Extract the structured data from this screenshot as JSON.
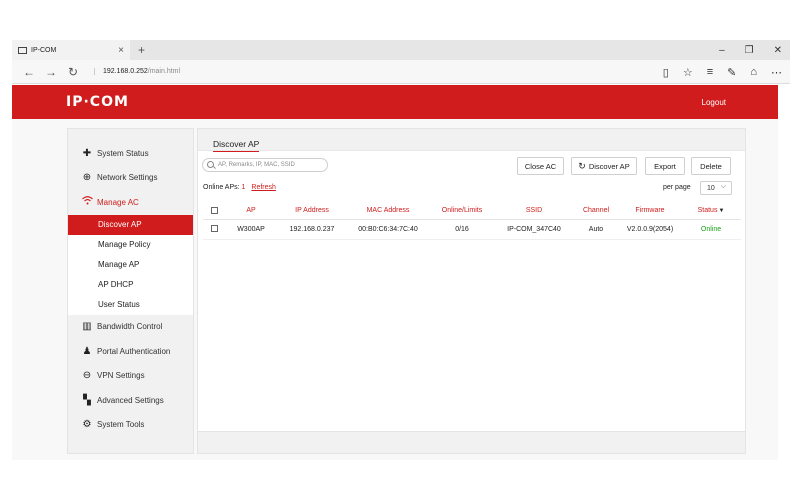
{
  "browser": {
    "tab_title": "IP-COM",
    "tab_close": "×",
    "new_tab": "+",
    "url_host": "192.168.0.252",
    "url_path": "/main.html",
    "win_min": "–",
    "win_max": "❐",
    "win_close": "✕"
  },
  "header": {
    "logo": "IP·COM",
    "logout": "Logout"
  },
  "sidebar": {
    "items": [
      {
        "label": "System Status",
        "icon": "pulse-icon"
      },
      {
        "label": "Network Settings",
        "icon": "globe-icon"
      },
      {
        "label": "Manage AC",
        "icon": "wifi-icon"
      },
      {
        "label": "Bandwidth Control",
        "icon": "chart-icon"
      },
      {
        "label": "Portal Authentication",
        "icon": "user-icon"
      },
      {
        "label": "VPN Settings",
        "icon": "vpn-icon"
      },
      {
        "label": "Advanced Settings",
        "icon": "grid-icon"
      },
      {
        "label": "System Tools",
        "icon": "gears-icon"
      }
    ],
    "subitems": [
      "Discover AP",
      "Manage Policy",
      "Manage AP",
      "AP DHCP",
      "User Status"
    ]
  },
  "main": {
    "title": "Discover AP",
    "search_placeholder": "AP, Remarks, IP, MAC, SSID",
    "buttons": {
      "close_ac": "Close AC",
      "discover_ap": "Discover AP",
      "export": "Export",
      "delete": "Delete"
    },
    "online_label": "Online APs:",
    "online_count": "1",
    "refresh": "Refresh",
    "per_page_label": "per page",
    "per_page_value": "10",
    "columns": [
      "AP",
      "IP Address",
      "MAC Address",
      "Online/Limits",
      "SSID",
      "Channel",
      "Firmware",
      "Status"
    ],
    "rows": [
      {
        "ap": "W300AP",
        "ip": "192.168.0.237",
        "mac": "00:B0:C6:34:7C:40",
        "online_limits": "0/16",
        "ssid": "IP-COM_347C40",
        "channel": "Auto",
        "firmware": "V2.0.0.9(2054)",
        "status": "Online"
      }
    ]
  },
  "colors": {
    "brand": "#d01c1c",
    "online": "#1aa21a"
  }
}
